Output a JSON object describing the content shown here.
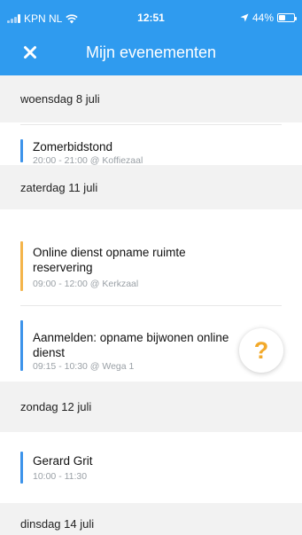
{
  "status_bar": {
    "carrier": "KPN NL",
    "time": "12:51",
    "battery": "44%",
    "battery_level": 0.44,
    "icons": [
      "signal-icon",
      "wifi-icon",
      "location-arrow-icon",
      "battery-icon"
    ]
  },
  "nav": {
    "title": "Mijn evenementen",
    "close_icon": "close-icon"
  },
  "colors": {
    "header_blue": "#2f9bef",
    "event_blue": "#3c93ea",
    "event_orange": "#f4b44a",
    "help_orange": "#f2a92a",
    "section_bg": "#f2f2f2"
  },
  "sections": [
    {
      "date": "woensdag 8 juli",
      "events": [
        {
          "title": "Zomerbidstond",
          "subtitle": "20:00 - 21:00 @ Koffiezaal",
          "color": "#3c93ea"
        }
      ]
    },
    {
      "date": "zaterdag 11 juli",
      "events": [
        {
          "title": "Online dienst opname ruimte reservering",
          "subtitle": "09:00 - 12:00 @ Kerkzaal",
          "color": "#f4b44a"
        },
        {
          "title": "Aanmelden: opname bijwonen online dienst",
          "subtitle": "09:15 - 10:30 @ Wega 1",
          "color": "#3c93ea"
        }
      ]
    },
    {
      "date": "zondag 12 juli",
      "events": [
        {
          "title": "Gerard Grit",
          "subtitle": "10:00 - 11:30",
          "color": "#3c93ea"
        }
      ]
    },
    {
      "date": "dinsdag 14 juli",
      "events": []
    }
  ],
  "help_button": {
    "label": "?",
    "icon": "question-mark-icon"
  }
}
